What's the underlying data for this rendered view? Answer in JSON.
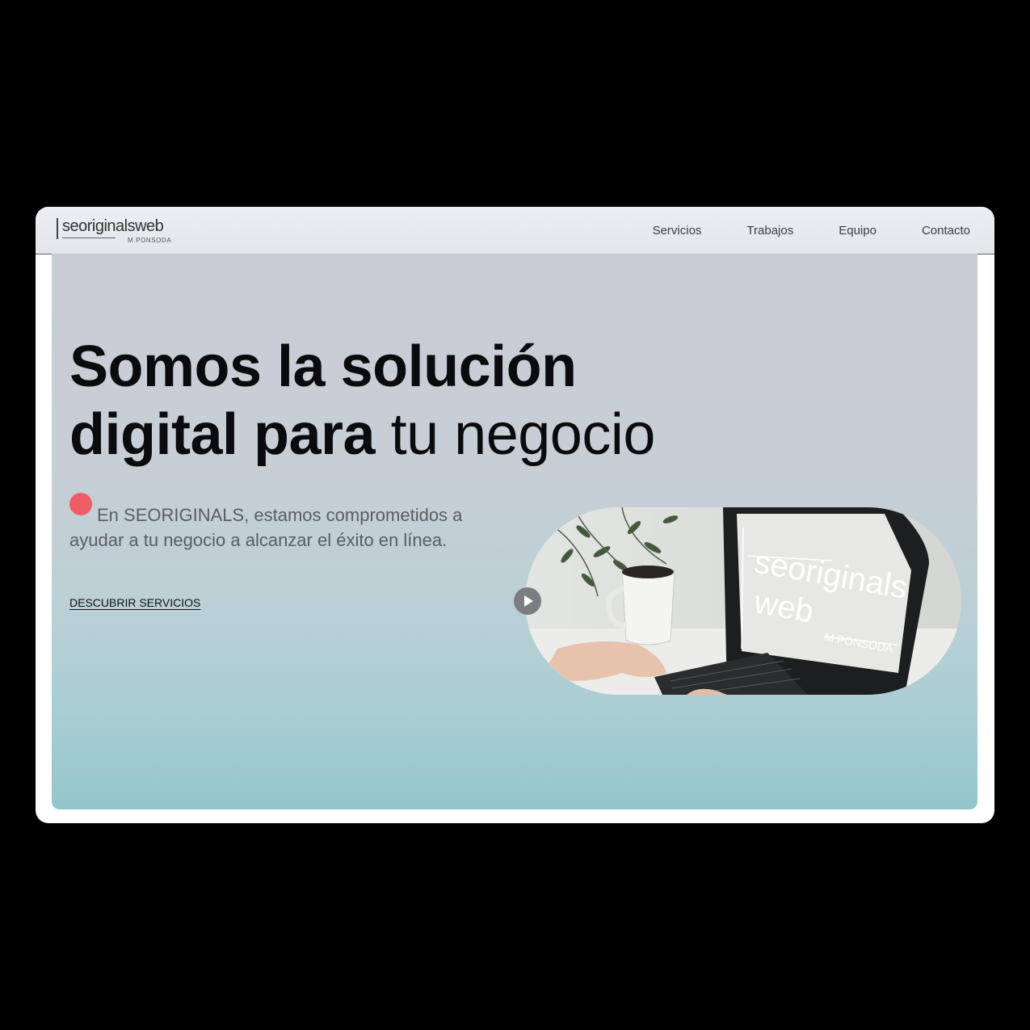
{
  "brand": {
    "logo_text": "seoriginalsweb",
    "logo_sub": "M.PONSODA"
  },
  "nav": {
    "items": [
      "Servicios",
      "Trabajos",
      "Equipo",
      "Contacto"
    ]
  },
  "hero": {
    "headline_line1": "Somos la solución",
    "headline_line2_bold": "digital para",
    "headline_line2_rest": "tu negocio",
    "lead": "En SEORIGINALS, estamos comprometidos a ayudar a tu negocio a alcanzar el éxito en línea.",
    "cta": "DESCUBRIR SERVICIOS"
  },
  "media": {
    "screen_line1": "seoriginals",
    "screen_line2": "web",
    "screen_line3": "M.PONSODA",
    "play_icon": "play-icon"
  },
  "colors": {
    "accent_dot": "#ee5d66",
    "hero_top": "#c7ccd6",
    "hero_bottom": "#93c6cc"
  }
}
